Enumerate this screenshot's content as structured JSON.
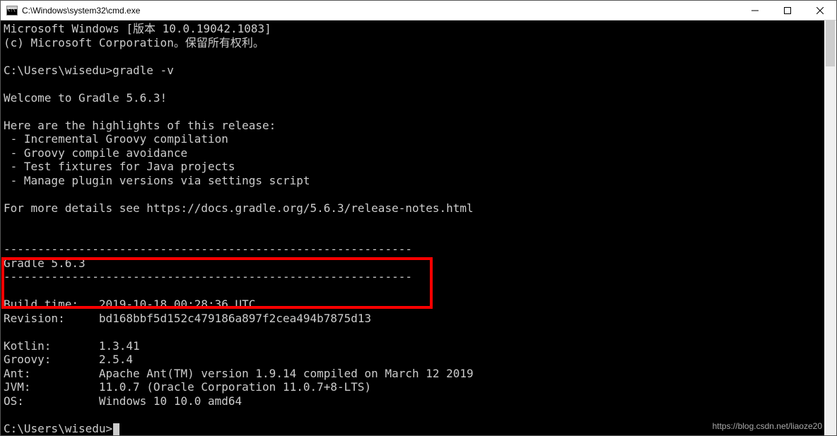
{
  "titlebar": {
    "title": "C:\\Windows\\system32\\cmd.exe"
  },
  "console": {
    "line1": "Microsoft Windows [版本 10.0.19042.1083]",
    "line2": "(c) Microsoft Corporation。保留所有权利。",
    "blank1": "",
    "prompt1": "C:\\Users\\wisedu>gradle -v",
    "blank2": "",
    "welcome": "Welcome to Gradle 5.6.3!",
    "blank3": "",
    "highlights_header": "Here are the highlights of this release:",
    "hl1": " - Incremental Groovy compilation",
    "hl2": " - Groovy compile avoidance",
    "hl3": " - Test fixtures for Java projects",
    "hl4": " - Manage plugin versions via settings script",
    "blank4": "",
    "details": "For more details see https://docs.gradle.org/5.6.3/release-notes.html",
    "blank5": "",
    "blank6": "",
    "sep1": "------------------------------------------------------------",
    "version": "Gradle 5.6.3",
    "sep2": "------------------------------------------------------------",
    "blank7": "",
    "buildtime": "Build time:   2019-10-18 00:28:36 UTC",
    "revision": "Revision:     bd168bbf5d152c479186a897f2cea494b7875d13",
    "blank8": "",
    "kotlin": "Kotlin:       1.3.41",
    "groovy": "Groovy:       2.5.4",
    "ant": "Ant:          Apache Ant(TM) version 1.9.14 compiled on March 12 2019",
    "jvm": "JVM:          11.0.7 (Oracle Corporation 11.0.7+8-LTS)",
    "os": "OS:           Windows 10 10.0 amd64",
    "blank9": "",
    "prompt2": "C:\\Users\\wisedu>"
  },
  "watermark": "https://blog.csdn.net/liaoze20"
}
